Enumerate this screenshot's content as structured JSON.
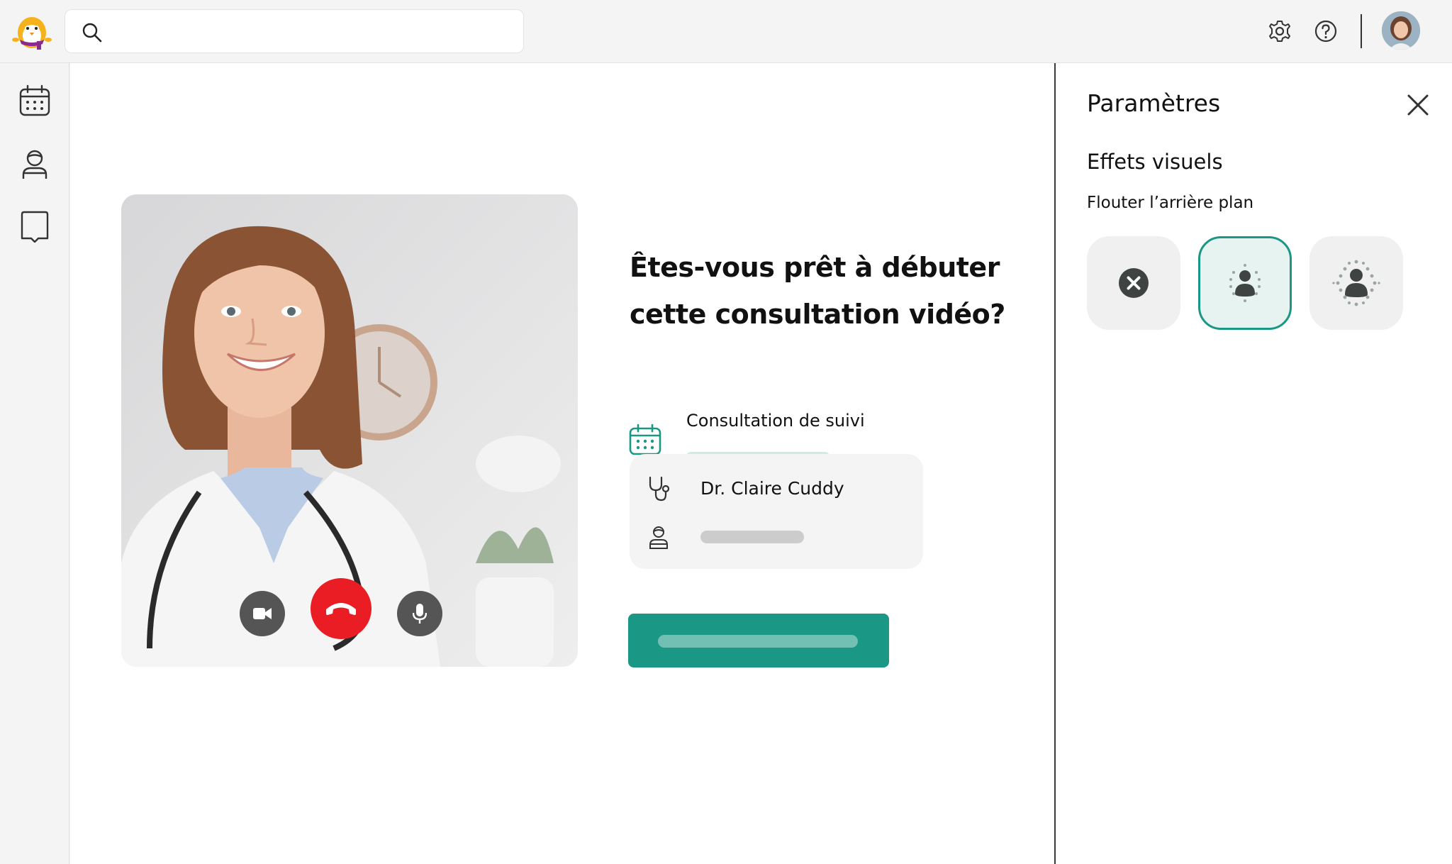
{
  "search": {
    "placeholder": "",
    "value": ""
  },
  "topbar": {
    "icons": [
      "settings-icon",
      "help-icon"
    ],
    "avatar": "user-avatar"
  },
  "sidebar": {
    "items": [
      {
        "icon": "calendar-icon",
        "name": "agenda"
      },
      {
        "icon": "patient-icon",
        "name": "patients"
      },
      {
        "icon": "book-icon",
        "name": "documents"
      }
    ]
  },
  "main": {
    "headline_line1": "Êtes-vous prêt à débuter",
    "headline_line2": "cette consultation vidéo?",
    "appointment": {
      "label": "Consultation de suivi"
    },
    "doctor": {
      "name": "Dr. Claire Cuddy"
    },
    "video_controls": [
      "camera-button",
      "hang-up-button",
      "microphone-button"
    ]
  },
  "panel": {
    "title": "Paramètres",
    "section_title": "Effets visuels",
    "section_subtitle": "Flouter l’arrière plan",
    "effects": [
      {
        "name": "none",
        "selected": false
      },
      {
        "name": "light-blur",
        "selected": true
      },
      {
        "name": "strong-blur",
        "selected": false
      }
    ]
  },
  "colors": {
    "accent": "#1b9785",
    "accent_light": "#cfeae4",
    "hangup": "#ea1c24",
    "panel_bg": "#ffffff",
    "chrome_bg": "#f4f4f4"
  }
}
